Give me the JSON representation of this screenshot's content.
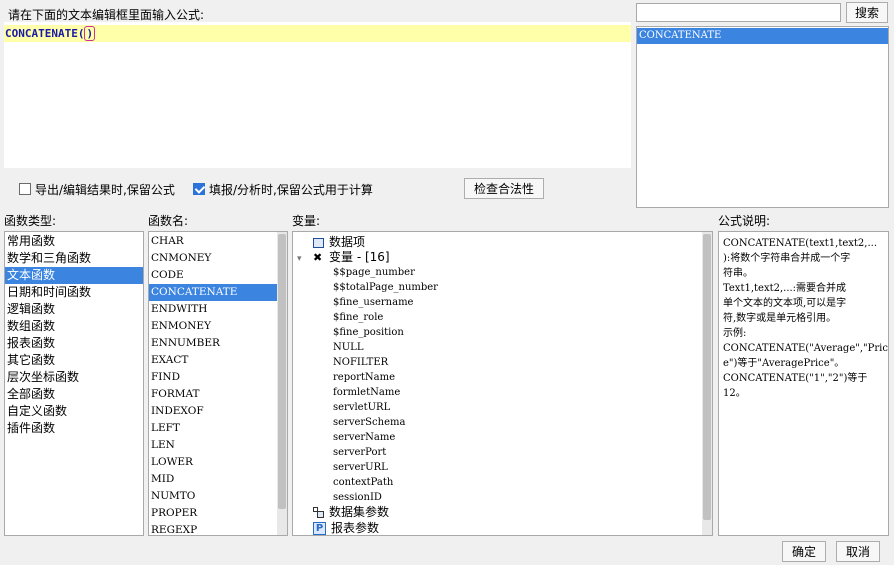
{
  "editor": {
    "prompt": "请在下面的文本编辑框里面输入公式:",
    "formula_name": "CONCATENATE",
    "formula_open": "(",
    "formula_close": ")"
  },
  "search": {
    "placeholder": "",
    "button_label": "搜索",
    "results": [
      "CONCATENATE"
    ]
  },
  "options": {
    "export_keep_label": "导出/编辑结果时,保留公式",
    "export_keep_checked": false,
    "fill_keep_label": "填报/分析时,保留公式用于计算",
    "fill_keep_checked": true,
    "check_button": "检查合法性"
  },
  "function_types": {
    "header": "函数类型:",
    "items": [
      "常用函数",
      "数学和三角函数",
      "文本函数",
      "日期和时间函数",
      "逻辑函数",
      "数组函数",
      "报表函数",
      "其它函数",
      "层次坐标函数",
      "全部函数",
      "自定义函数",
      "插件函数"
    ],
    "selected": "文本函数"
  },
  "function_names": {
    "header": "函数名:",
    "items": [
      "CHAR",
      "CNMONEY",
      "CODE",
      "CONCATENATE",
      "ENDWITH",
      "ENMONEY",
      "ENNUMBER",
      "EXACT",
      "FIND",
      "FORMAT",
      "INDEXOF",
      "LEFT",
      "LEN",
      "LOWER",
      "MID",
      "NUMTO",
      "PROPER",
      "REGEXP"
    ],
    "selected": "CONCATENATE"
  },
  "variables": {
    "header": "变量:",
    "data_items": "数据项",
    "var_group": "变量 - [16]",
    "var_list": [
      "$$page_number",
      "$$totalPage_number",
      "$fine_username",
      "$fine_role",
      "$fine_position",
      "NULL",
      "NOFILTER",
      "reportName",
      "formletName",
      "servletURL",
      "serverSchema",
      "serverName",
      "serverPort",
      "serverURL",
      "contextPath",
      "sessionID"
    ],
    "dataset_params": "数据集参数",
    "report_params": "报表参数"
  },
  "description": {
    "header": "公式说明:",
    "lines": [
      "CONCATENATE(text1,text2,...",
      "):将数个字符串合并成一个字",
      "符串。",
      "Text1,text2,...:需要合并成",
      "单个文本的文本项,可以是字",
      "符,数字或是单元格引用。",
      "示例:",
      "CONCATENATE(\"Average\",\"Pric",
      "e\")等于\"AveragePrice\"。",
      "CONCATENATE(\"1\",\"2\")等于",
      "12。"
    ]
  },
  "footer": {
    "ok": "确定",
    "cancel": "取消"
  },
  "colors": {
    "selection": "#3b84e0",
    "editor_highlight": "#ffffaa",
    "formula_text": "#1a1aa6"
  }
}
